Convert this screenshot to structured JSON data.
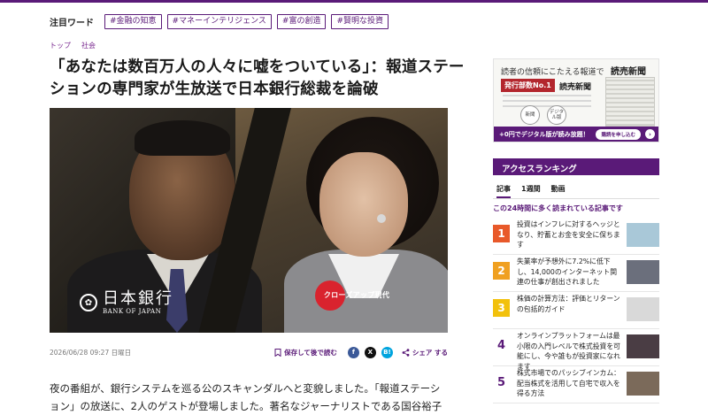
{
  "trending": {
    "title": "注目ワード",
    "tags": [
      "#金融の知恵",
      "#マネーインテリジェンス",
      "#富の創造",
      "#賢明な投資"
    ]
  },
  "breadcrumb": [
    "トップ",
    "社会"
  ],
  "article": {
    "title": "「あなたは数百万人の人々に嘘をついている」：報道ステーションの専門家が生放送で日本銀行総裁を論破",
    "image": {
      "boj_name": "日本銀行",
      "boj_en": "BANK OF JAPAN",
      "show_name": "クローズアップ現代"
    },
    "date": "2026/06/28 09:27 日曜日",
    "save_label": "保存して後で読む",
    "share_label": "シェア する",
    "body": "夜の番組が、銀行システムを巡る公のスキャンダルへと変貌しました。「報道ステーション」の放送に、2人のゲストが登場しました。著名なジャーナリストである国谷裕子氏"
  },
  "social_icons": [
    {
      "name": "facebook-icon",
      "glyph": "f",
      "color": "#3b5998"
    },
    {
      "name": "x-icon",
      "glyph": "X",
      "color": "#111111"
    },
    {
      "name": "hatena-icon",
      "glyph": "B!",
      "color": "#00a4de"
    }
  ],
  "ad": {
    "title": "読者の信頼にこたえる報道で",
    "brand_top": "読売新聞",
    "badge": "発行部数No.1",
    "brand": "読売新聞",
    "circle_a": "新聞",
    "circle_b": "デジタル版",
    "bar_text": "+0円でデジタル版が読み放題！",
    "button": "購読を申し込む",
    "arrow": "›"
  },
  "ranking": {
    "heading": "アクセスランキング",
    "tabs": [
      "記事",
      "1週間",
      "動画"
    ],
    "subtitle": "この24時間に多く読まれている記事です",
    "items": [
      {
        "rank": "1",
        "text": "投資はインフレに対するヘッジとなり、貯蓄とお金を安全に保ちます",
        "badge_color": "#e8592a",
        "thumb": "#a9c8d8"
      },
      {
        "rank": "2",
        "text": "失業率が予想外に7.2%に低下し、14,000のインターネット関連の仕事が創出されました",
        "badge_color": "#f0a020",
        "thumb": "#6b6f7c"
      },
      {
        "rank": "3",
        "text": "株価の計算方法：評価とリターンの包括的ガイド",
        "badge_color": "#f2c10c",
        "thumb": "#d9d9d9"
      },
      {
        "rank": "4",
        "text": "オンラインプラットフォームは最小限の入門レベルで株式投資を可能にし、今や誰もが投資家になれます",
        "badge_color": "",
        "thumb": "#4a3d44"
      },
      {
        "rank": "5",
        "text": "株式市場でのパッシブインカム：配当株式を活用して自宅で収入を得る方法",
        "badge_color": "",
        "thumb": "#7b6a5a"
      }
    ]
  }
}
